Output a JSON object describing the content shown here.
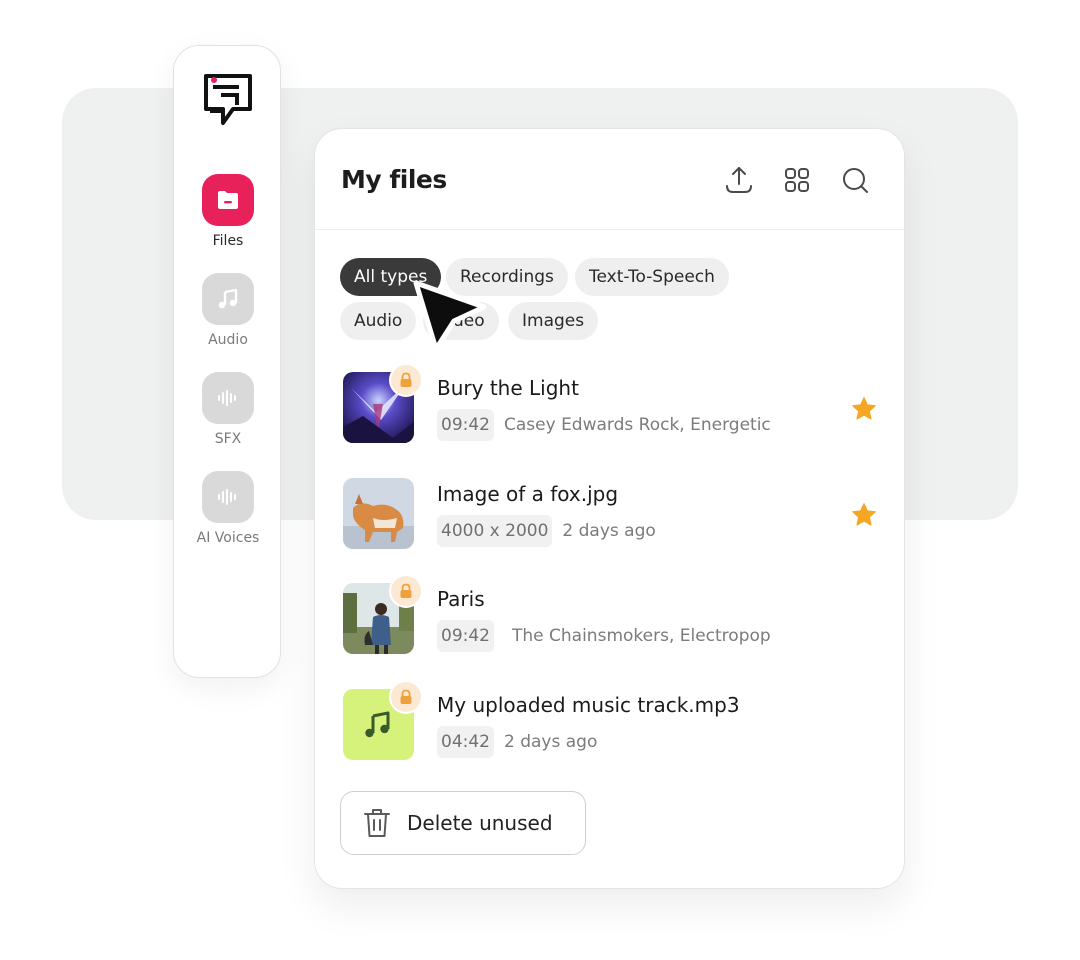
{
  "sidebar": {
    "items": [
      {
        "label": "Files",
        "icon": "folder-icon",
        "active": true
      },
      {
        "label": "Audio",
        "icon": "music-note-icon",
        "active": false
      },
      {
        "label": "SFX",
        "icon": "waveform-icon",
        "active": false
      },
      {
        "label": "AI Voices",
        "icon": "waveform-icon",
        "active": false
      }
    ]
  },
  "header": {
    "title": "My files",
    "actions": [
      "upload-icon",
      "grid-view-icon",
      "search-icon"
    ]
  },
  "filters": {
    "active": "All types",
    "chips": [
      "All types",
      "Recordings",
      "Text-To-Speech",
      "Audio",
      "Video",
      "Images"
    ]
  },
  "files": [
    {
      "name": "Bury the Light",
      "badge": "09:42",
      "meta": "Casey Edwards  Rock, Energetic",
      "locked": true,
      "starred": true
    },
    {
      "name": "Image of a fox.jpg",
      "badge": "4000 x 2000",
      "meta": "2 days ago",
      "locked": false,
      "starred": true
    },
    {
      "name": "Paris",
      "badge": "09:42",
      "meta": "The Chainsmokers, Electropop",
      "locked": true,
      "starred": false
    },
    {
      "name": "My uploaded music track.mp3",
      "badge": "04:42",
      "meta": "2 days ago",
      "locked": true,
      "starred": false
    }
  ],
  "footer": {
    "delete_label": "Delete unused"
  },
  "colors": {
    "accent": "#e8215a",
    "star": "#f5a623",
    "lock": "#f0a23a",
    "music_thumb": "#d7f27a"
  }
}
